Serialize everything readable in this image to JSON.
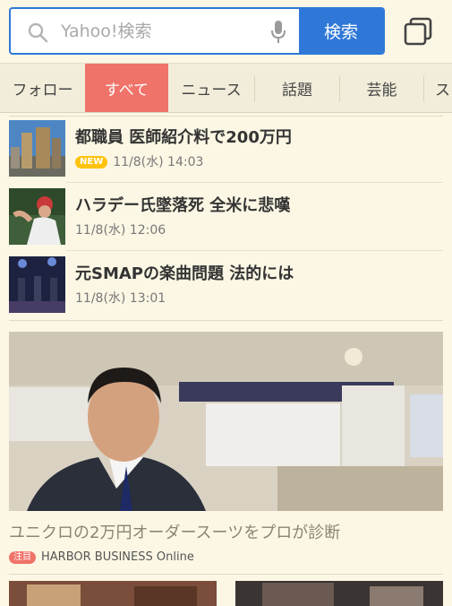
{
  "search": {
    "placeholder": "Yahoo!検索",
    "button_label": "検索"
  },
  "tabs": [
    {
      "label": "フォロー",
      "active": false
    },
    {
      "label": "すべて",
      "active": true
    },
    {
      "label": "ニュース",
      "active": false
    },
    {
      "label": "話題",
      "active": false
    },
    {
      "label": "芸能",
      "active": false
    },
    {
      "label": "ス",
      "active": false
    }
  ],
  "news": [
    {
      "title": "都職員 医師紹介料で200万円",
      "badge": "NEW",
      "date": "11/8(水) 14:03"
    },
    {
      "title": "ハラデー氏墜落死 全米に悲嘆",
      "badge": "",
      "date": "11/8(水) 12:06"
    },
    {
      "title": "元SMAPの楽曲問題 法的には",
      "badge": "",
      "date": "11/8(水) 13:01"
    }
  ],
  "feature": {
    "title": "ユニクロの2万円オーダースーツをプロが診断",
    "badge": "注目",
    "source": "HARBOR BUSINESS Online"
  },
  "colors": {
    "accent_blue": "#2f78d7",
    "active_tab": "#f0736a",
    "background": "#fcf7e4",
    "new_badge": "#ffc20e"
  }
}
